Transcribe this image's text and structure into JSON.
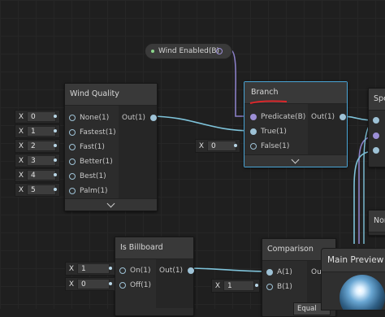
{
  "wind_enabled": {
    "label": "Wind Enabled(B)"
  },
  "wind_quality": {
    "title": "Wind Quality",
    "output": "Out(1)",
    "inputs": [
      "None(1)",
      "Fastest(1)",
      "Fast(1)",
      "Better(1)",
      "Best(1)",
      "Palm(1)"
    ],
    "values": [
      "0",
      "1",
      "2",
      "3",
      "4",
      "5"
    ]
  },
  "branch": {
    "title": "Branch",
    "output": "Out(1)",
    "inputs": [
      "Predicate(B)",
      "True(1)",
      "False(1)"
    ],
    "false_value": "0"
  },
  "is_billboard": {
    "title": "Is Billboard",
    "output": "Out(1)",
    "inputs": [
      "On(1)",
      "Off(1)"
    ],
    "values": [
      "1",
      "0"
    ]
  },
  "comparison": {
    "title": "Comparison",
    "output_short": "Ou",
    "inputs": [
      "A(1)",
      "B(1)"
    ],
    "b_value": "1",
    "dropdown": "Equal"
  },
  "main_preview": {
    "title": "Main Preview"
  },
  "partial_nodes": {
    "top_right_title": "Spe",
    "mid_right_title": "Nor"
  },
  "field_axis": "X",
  "colors": {
    "wire_float": "#7ec3da",
    "wire_bool": "#8a7fc6",
    "selection": "#4aa5d6",
    "annotation": "#e0262a"
  }
}
